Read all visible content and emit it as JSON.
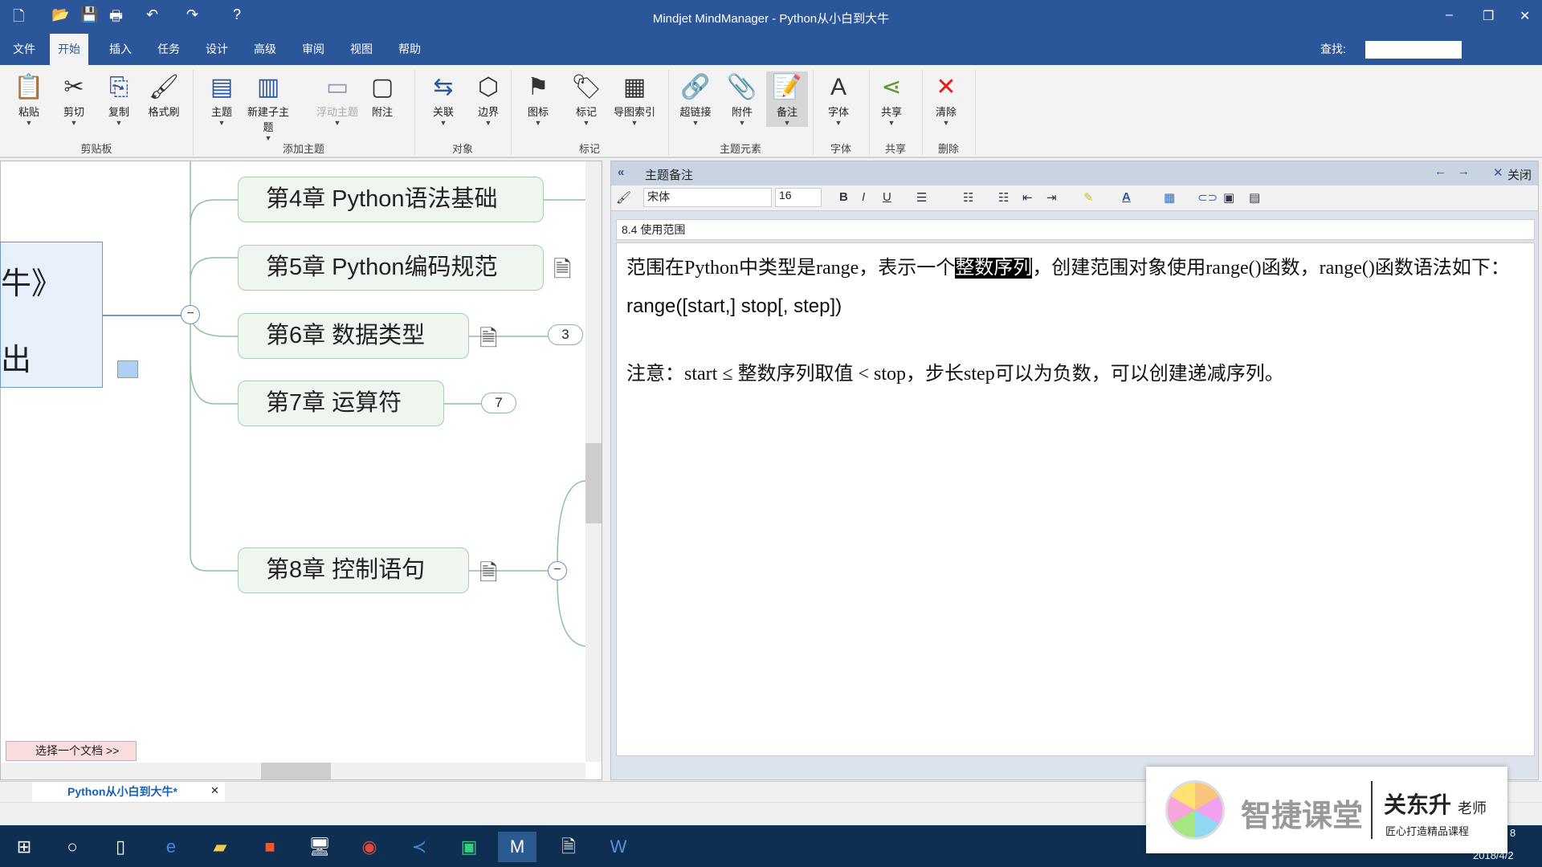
{
  "window": {
    "title": "Mindjet MindManager - Python从小白到大牛",
    "minimize": "–",
    "restore": "❐",
    "close": "✕"
  },
  "quick_access": [
    "🗋",
    "📂",
    "💾",
    "🖶",
    "↶",
    "↷",
    "?"
  ],
  "menu": {
    "tabs": [
      "文件",
      "开始",
      "插入",
      "任务",
      "设计",
      "高级",
      "审阅",
      "视图",
      "帮助"
    ],
    "active": 1,
    "find_label": "查找:"
  },
  "ribbon": {
    "buttons": [
      {
        "label": "粘贴",
        "icon": "📋"
      },
      {
        "label": "剪切",
        "icon": "✂"
      },
      {
        "label": "复制",
        "icon": "⎘"
      },
      {
        "label": "格式刷",
        "icon": "🖌"
      },
      {
        "label": "主题",
        "icon": "▤"
      },
      {
        "label": "新建子主题",
        "icon": "▥"
      },
      {
        "label": "浮动主题",
        "icon": "▭"
      },
      {
        "label": "附注",
        "icon": "▢"
      },
      {
        "label": "关联",
        "icon": "⇆"
      },
      {
        "label": "边界",
        "icon": "⬡"
      },
      {
        "label": "图标",
        "icon": "⚑"
      },
      {
        "label": "标记",
        "icon": "🏷"
      },
      {
        "label": "导图索引",
        "icon": "▦"
      },
      {
        "label": "超链接",
        "icon": "🔗"
      },
      {
        "label": "附件",
        "icon": "📎"
      },
      {
        "label": "备注",
        "icon": "📝"
      },
      {
        "label": "字体",
        "icon": "A"
      },
      {
        "label": "共享",
        "icon": "⋖"
      },
      {
        "label": "清除",
        "icon": "✕"
      }
    ],
    "groups": [
      "剪贴板",
      "添加主题",
      "对象",
      "标记",
      "主题元素",
      "字体",
      "共享",
      "删除"
    ]
  },
  "map": {
    "central_text_1": "牛》",
    "central_text_2": "出",
    "nodes": [
      "第4章 Python语法基础",
      "第5章 Python编码规范",
      "第6章 数据类型",
      "第7章 运算符",
      "第8章 控制语句"
    ],
    "badges": [
      "3",
      "7"
    ],
    "collapse": "−",
    "doc_selector": "选择一个文档 >>"
  },
  "notes": {
    "header": "主题备注",
    "close": "关闭",
    "font": "宋体",
    "size": "16",
    "title": "8.4 使用范围",
    "line1_a": "范围在Python中类型是range，表示一个",
    "line1_hl": "整数序列",
    "line1_b": "，创建范围对象使用range()函数，range()函数语法如下：",
    "code": "range([start,] stop[, step])",
    "note": "注意：start ≤ 整数序列取值 < stop，步长step可以为负数，可以创建递减序列。"
  },
  "doctab": {
    "label": "Python从小白到大牛*"
  },
  "taskbar": {
    "date": "2018/4/2",
    "time": "8"
  },
  "watermark": {
    "brand": "智捷课堂",
    "teacher": "关东升",
    "title": "老师",
    "slogan": "匠心打造精品课程"
  },
  "colors": {
    "titlebar": "#2b579a",
    "node_fill": "#eef6ef",
    "node_border": "#a9cdb1",
    "taskbar": "#0e2f52"
  }
}
